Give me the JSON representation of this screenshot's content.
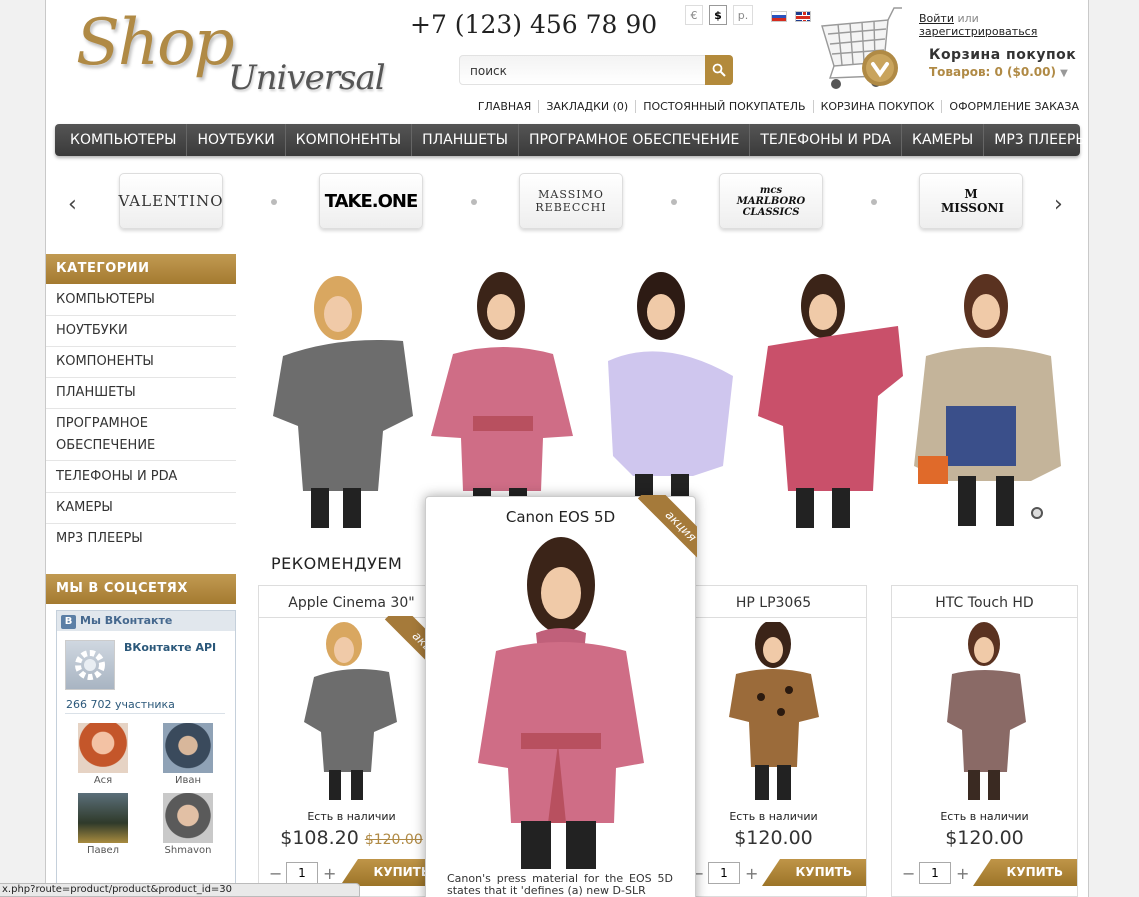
{
  "logo": {
    "shop": "Shop",
    "universal": "Universal"
  },
  "phone": "+7 (123) 456 78 90",
  "search": {
    "placeholder": "поиск"
  },
  "currencies": [
    "€",
    "$",
    "р."
  ],
  "auth": {
    "login": "Войти",
    "or": "или",
    "register": "зарегистрироваться"
  },
  "cart": {
    "title": "Корзина покупок",
    "count": "Товаров: 0 ($0.00)"
  },
  "toplinks": [
    "ГЛАВНАЯ",
    "ЗАКЛАДКИ (0)",
    "ПОСТОЯННЫЙ ПОКУПАТЕЛЬ",
    "КОРЗИНА ПОКУПОК",
    "ОФОРМЛЕНИЕ ЗАКАЗА"
  ],
  "menu": [
    "КОМПЬЮТЕРЫ",
    "НОУТБУКИ",
    "КОМПОНЕНТЫ",
    "ПЛАНШЕТЫ",
    "ПРОГРАМНОЕ ОБЕСПЕЧЕНИЕ",
    "ТЕЛЕФОНЫ И PDA",
    "КАМЕРЫ",
    "MP3 ПЛЕЕРЫ"
  ],
  "brands": [
    "VALENTINO",
    "TAKE.ONE",
    "MASSIMO REBECCHI",
    "mcs MARLBORO CLASSICS",
    "M MISSONI"
  ],
  "sidebar": {
    "categories_title": "КАТЕГОРИИ",
    "categories": [
      "КОМПЬЮТЕРЫ",
      "НОУТБУКИ",
      "КОМПОНЕНТЫ",
      "ПЛАНШЕТЫ",
      "ПРОГРАМНОЕ ОБЕСПЕЧЕНИЕ",
      "ТЕЛЕФОНЫ И PDA",
      "КАМЕРЫ",
      "MP3 ПЛЕЕРЫ"
    ],
    "social_title": "МЫ В СОЦСЕТЯХ",
    "vk": {
      "header": "Мы ВКонтакте",
      "api": "ВКонтакте API",
      "members": "266 702 участника",
      "users": [
        "Ася",
        "Иван",
        "Павел",
        "Shmavon"
      ]
    }
  },
  "recommend_title": "РЕКОМЕНДУЕМ",
  "products": [
    {
      "name": "Apple Cinema 30\"",
      "stock": "Есть в наличии",
      "price": "$108.20",
      "old_price": "$120.00",
      "qty": "1",
      "buy": "КУПИТЬ",
      "badge": "акция"
    },
    {
      "name": "HP LP3065",
      "stock": "Есть в наличии",
      "price": "$120.00",
      "qty": "1",
      "buy": "КУПИТЬ"
    },
    {
      "name": "HTC Touch HD",
      "stock": "Есть в наличии",
      "price": "$120.00",
      "qty": "1",
      "buy": "КУПИТЬ"
    }
  ],
  "popup": {
    "title": "Canon EOS 5D",
    "badge": "акция",
    "description": "Canon's press material for the EOS 5D states that it 'defines (a) new D-SLR"
  },
  "status_url": "x.php?route=product/product&product_id=30",
  "colors": {
    "accent": "#b08a45",
    "menu": "#444444"
  }
}
